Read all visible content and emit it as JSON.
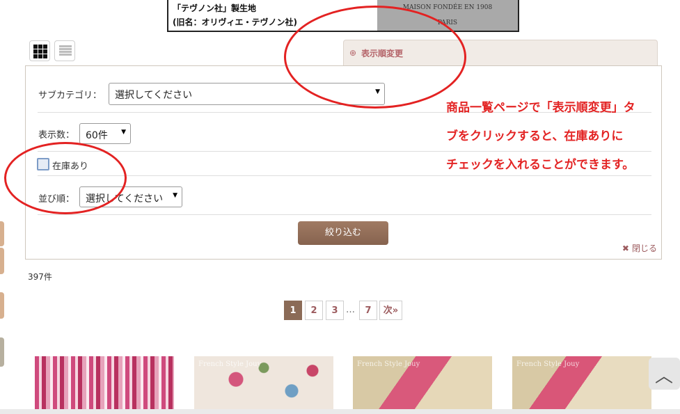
{
  "banner": {
    "line1": "「テヴノン社」製生地",
    "line2": "(旧名：オリヴィエ・テヴノン社)",
    "right_line1": "MAISON FONDÉE EN 1908",
    "right_line2": "PARIS"
  },
  "sort_tab": {
    "icon": "zoom-in-icon",
    "label": "表示順変更"
  },
  "filters": {
    "subcategory_label": "サブカテゴリ：",
    "subcategory_value": "選択してください",
    "count_label": "表示数：",
    "count_value": "60件",
    "in_stock_label": "在庫あり",
    "order_label": "並び順：",
    "order_value": "選択してください",
    "apply_label": "絞り込む",
    "close_label": "閉じる"
  },
  "results": {
    "count": "397件"
  },
  "pager": {
    "pages": [
      "1",
      "2",
      "3",
      "7"
    ],
    "dots": "…",
    "next": "次»",
    "current": "1"
  },
  "annotation": {
    "line1": "商品一覧ページで「表示順変更」タ",
    "line2": "ブをクリックすると、在庫ありに",
    "line3": "チェックを入れることができます。"
  },
  "products": [
    {
      "watermark": ""
    },
    {
      "watermark": "French Style Jouy"
    },
    {
      "watermark": "French Style Jouy"
    },
    {
      "watermark": "French Style Jouy"
    }
  ],
  "colors": {
    "accent": "#b5656a",
    "button": "#8b6b57",
    "annotation": "#e32424"
  }
}
